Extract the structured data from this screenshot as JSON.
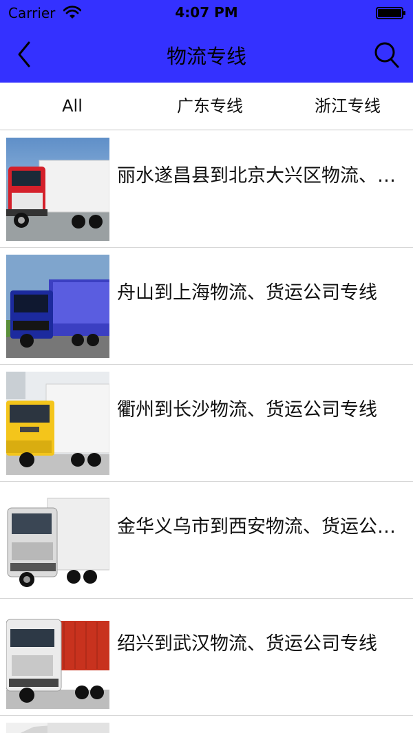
{
  "status_bar": {
    "carrier": "Carrier",
    "time": "4:07 PM",
    "icons": [
      "wifi-icon",
      "battery-icon"
    ]
  },
  "nav": {
    "title": "物流专线",
    "back_icon": "chevron-left-icon",
    "search_icon": "search-icon"
  },
  "tabs": [
    {
      "label": "All"
    },
    {
      "label": "广东专线"
    },
    {
      "label": "浙江专线"
    }
  ],
  "routes": [
    {
      "title": "丽水遂昌县到北京大兴区物流、货运公司专线",
      "thumb": "truck-red-photo"
    },
    {
      "title": "舟山到上海物流、货运公司专线",
      "thumb": "truck-blue-photo"
    },
    {
      "title": "衢州到长沙物流、货运公司专线",
      "thumb": "truck-yellow-photo"
    },
    {
      "title": "金华义乌市到西安物流、货运公司专线",
      "thumb": "truck-white-photo"
    },
    {
      "title": "绍兴到武汉物流、货运公司专线",
      "thumb": "truck-white-red-container-photo"
    }
  ],
  "colors": {
    "header": "#3431ff",
    "background": "#ffffff",
    "divider": "#d6d6d6"
  }
}
